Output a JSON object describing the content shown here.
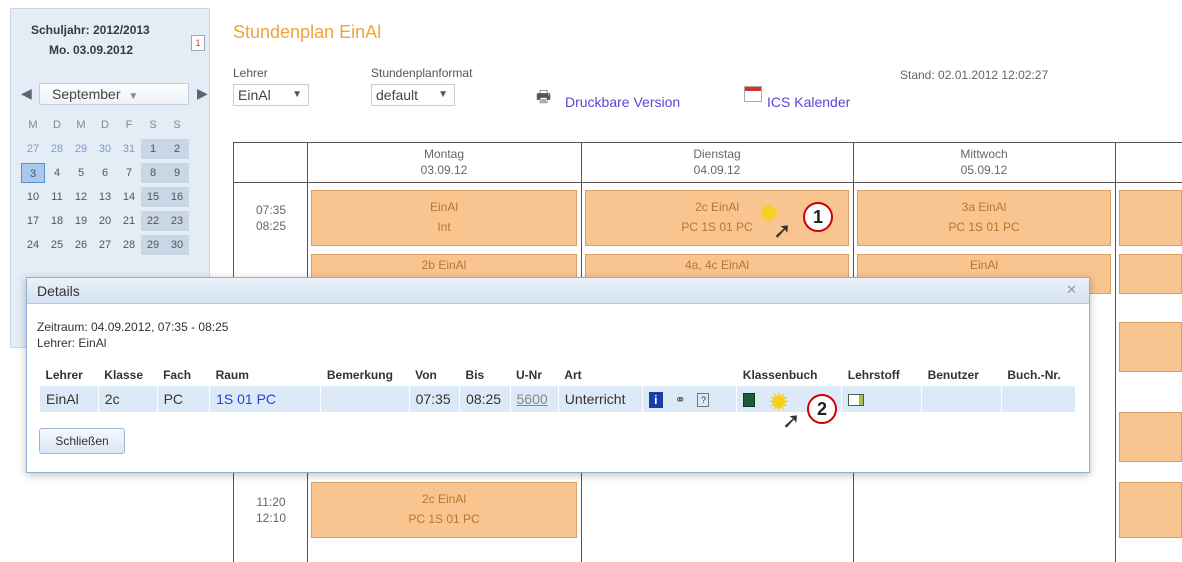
{
  "calendar": {
    "school_year": "Schuljahr: 2012/2013",
    "date": "Mo. 03.09.2012",
    "month": "September",
    "weekday_heads": [
      "M",
      "D",
      "M",
      "D",
      "F",
      "S",
      "S"
    ],
    "weeks": [
      [
        "27",
        "28",
        "29",
        "30",
        "31",
        "1",
        "2"
      ],
      [
        "3",
        "4",
        "5",
        "6",
        "7",
        "8",
        "9"
      ],
      [
        "10",
        "11",
        "12",
        "13",
        "14",
        "15",
        "16"
      ],
      [
        "17",
        "18",
        "19",
        "20",
        "21",
        "22",
        "23"
      ],
      [
        "24",
        "25",
        "26",
        "27",
        "28",
        "29",
        "30"
      ]
    ]
  },
  "header": {
    "title": "Stundenplan EinAl",
    "teacher_label": "Lehrer",
    "teacher_value": "EinAl",
    "format_label": "Stundenplanformat",
    "format_value": "default",
    "print_link": "Druckbare Version",
    "ics_link": "ICS Kalender",
    "stand": "Stand: 02.01.2012 12:02:27"
  },
  "timetable": {
    "days": [
      {
        "name": "Montag",
        "date": "03.09.12"
      },
      {
        "name": "Dienstag",
        "date": "04.09.12"
      },
      {
        "name": "Mittwoch",
        "date": "05.09.12"
      }
    ],
    "times": [
      {
        "start": "07:35",
        "end": "08:25"
      },
      {
        "start": "11:20",
        "end": "12:10"
      }
    ],
    "lessons": [
      {
        "l1": "EinAl",
        "l2": "Int"
      },
      {
        "l1": "2c   EinAl",
        "l2": "PC 1S 01 PC"
      },
      {
        "l1": "3a   EinAl",
        "l2": "PC 1S 01 PC"
      },
      {
        "l1": "2b   EinAl"
      },
      {
        "l1": "4a, 4c   EinAl"
      },
      {
        "l1": "EinAl"
      },
      {
        "l1": "2c   EinAl",
        "l2": "PC 1S 01 PC"
      }
    ]
  },
  "details": {
    "title": "Details",
    "zeitraum": "Zeitraum: 04.09.2012, 07:35 - 08:25",
    "lehrer": "Lehrer: EinAl",
    "columns": [
      "Lehrer",
      "Klasse",
      "Fach",
      "Raum",
      "Bemerkung",
      "Von",
      "Bis",
      "U-Nr",
      "Art",
      "",
      "Klassenbuch",
      "Lehrstoff",
      "Benutzer",
      "Buch.-Nr."
    ],
    "row": {
      "lehrer": "EinAl",
      "klasse": "2c",
      "fach": "PC",
      "raum": "1S 01 PC",
      "bemerkung": "",
      "von": "07:35",
      "bis": "08:25",
      "unr": "5600",
      "art": "Unterricht"
    },
    "close_button": "Schließen"
  },
  "callouts": [
    "1",
    "2"
  ]
}
